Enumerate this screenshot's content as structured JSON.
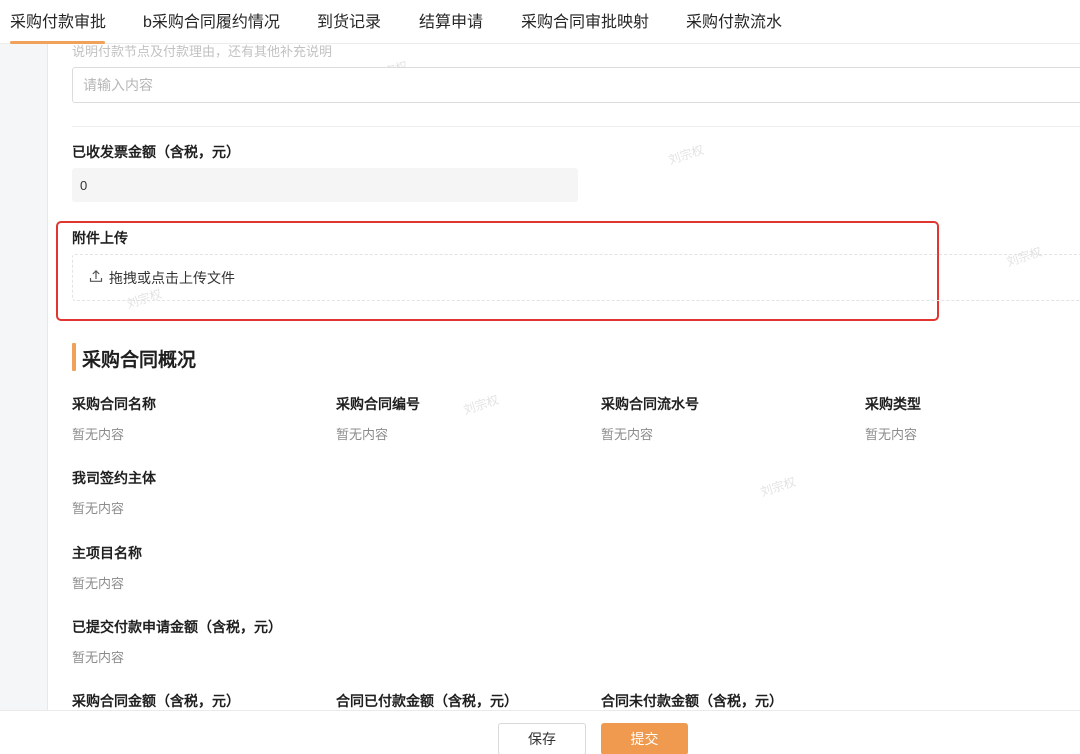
{
  "tabs": [
    {
      "label": "采购付款审批"
    },
    {
      "label": "b采购合同履约情况"
    },
    {
      "label": "到货记录"
    },
    {
      "label": "结算申请"
    },
    {
      "label": "采购合同审批映射"
    },
    {
      "label": "采购付款流水"
    }
  ],
  "watermark": "刘宗权",
  "payment_reason": {
    "hint": "说明付款节点及付款理由，还有其他补充说明",
    "placeholder": "请输入内容"
  },
  "invoice_amount": {
    "label": "已收发票金额（含税，元）",
    "value": "0"
  },
  "attachment": {
    "label": "附件上传",
    "upload_text": "拖拽或点击上传文件"
  },
  "contract_overview": {
    "title": "采购合同概况",
    "empty_text": "暂无内容",
    "fields": [
      {
        "label": "采购合同名称",
        "value": "暂无内容"
      },
      {
        "label": "采购合同编号",
        "value": "暂无内容"
      },
      {
        "label": "采购合同流水号",
        "value": "暂无内容"
      },
      {
        "label": "采购类型",
        "value": "暂无内容"
      },
      {
        "label": "我司签约主体",
        "value": "暂无内容"
      },
      {
        "label": "主项目名称",
        "value": "暂无内容"
      },
      {
        "label": "已提交付款申请金额（含税，元）",
        "value": "暂无内容"
      },
      {
        "label": "采购合同金额（含税，元）"
      },
      {
        "label": "合同已付款金额（含税，元）"
      },
      {
        "label": "合同未付款金额（含税，元）"
      }
    ]
  },
  "footer": {
    "save_label": "保存",
    "submit_label": "提交"
  },
  "colors": {
    "accent": "#ef9a4e",
    "highlight_border": "#e0362f"
  }
}
